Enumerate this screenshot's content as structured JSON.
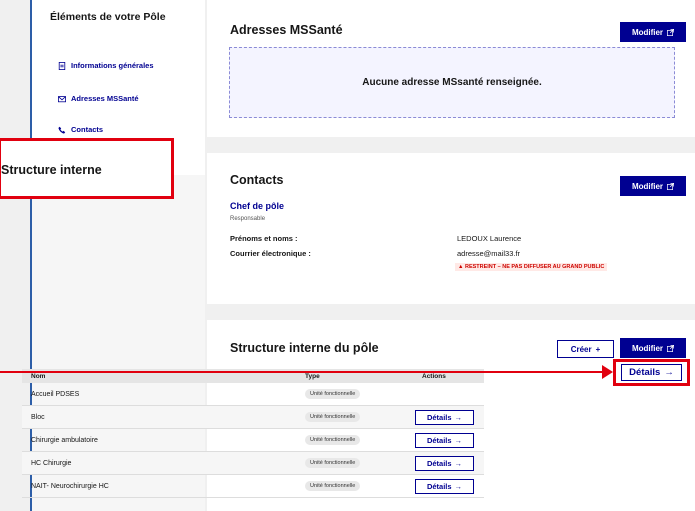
{
  "sidebar": {
    "title": "Éléments de votre Pôle",
    "items": [
      {
        "label": "Informations générales",
        "icon": "document-icon"
      },
      {
        "label": "Adresses MSSanté",
        "icon": "mail-icon"
      },
      {
        "label": "Contacts",
        "icon": "phone-icon"
      }
    ],
    "highlighted_item": "Structure interne"
  },
  "mss": {
    "title": "Adresses MSSanté",
    "modify_label": "Modifier",
    "empty_text": "Aucune adresse MSsanté renseignée."
  },
  "contacts": {
    "title": "Contacts",
    "modify_label": "Modifier",
    "role_title": "Chef de pôle",
    "role_sub": "Responsable",
    "name_label": "Prénoms et noms :",
    "name_value": "LEDOUX Laurence",
    "email_label": "Courrier électronique :",
    "email_value": "adresse@mail33.fr",
    "warning": "▲ RESTREINT – NE PAS DIFFUSER AU GRAND PUBLIC"
  },
  "structure": {
    "title": "Structure interne du pôle",
    "create_label": "Créer",
    "modify_label": "Modifier",
    "columns": [
      "Nom",
      "Type",
      "Actions"
    ],
    "rows": [
      {
        "name": "Accueil PDSES",
        "type": "Unité fonctionnelle",
        "action": "Détails"
      },
      {
        "name": "Bloc",
        "type": "Unité fonctionnelle",
        "action": "Détails"
      },
      {
        "name": "Chirurgie ambulatoire",
        "type": "Unité fonctionnelle",
        "action": "Détails"
      },
      {
        "name": "HC Chirurgie",
        "type": "Unité fonctionnelle",
        "action": "Détails"
      },
      {
        "name": "NAIT- Neurochirurgie HC",
        "type": "Unité fonctionnelle",
        "action": "Détails"
      }
    ]
  },
  "colors": {
    "primary": "#000091",
    "highlight": "#e1000f"
  }
}
